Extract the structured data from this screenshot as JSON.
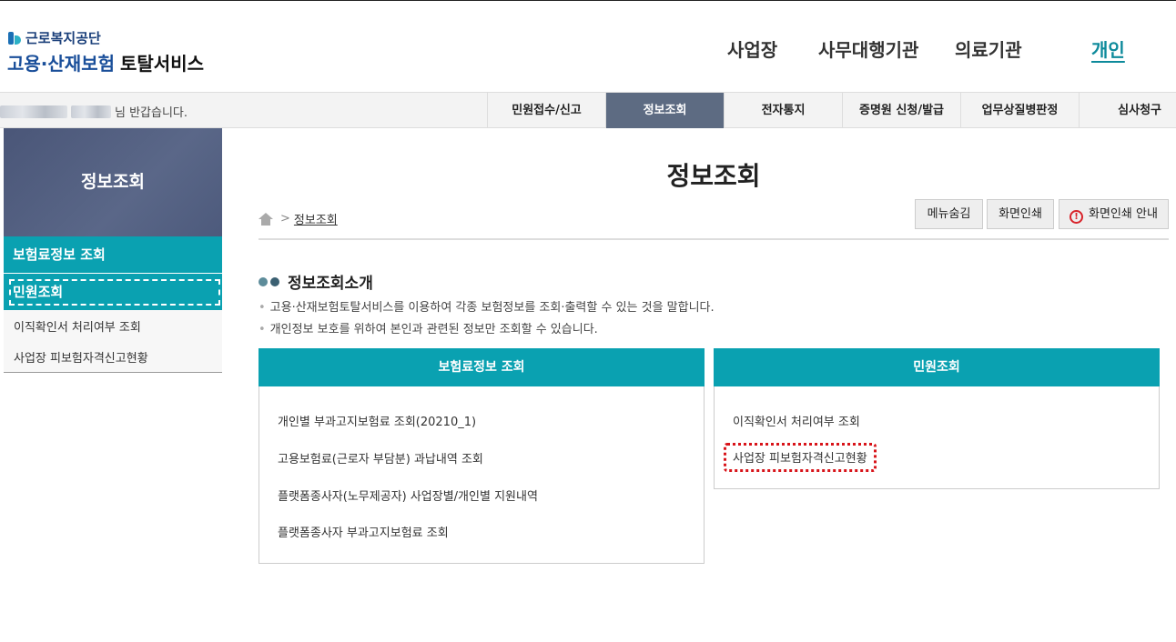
{
  "header": {
    "org_name": "근로복지공단",
    "service_name_a": "고용·산재보험",
    "service_name_b": "토탈서비스",
    "nav": [
      {
        "label": "사업장"
      },
      {
        "label": "사무대행기관"
      },
      {
        "label": "의료기관"
      },
      {
        "label": "개인"
      }
    ]
  },
  "menubar": {
    "greeting": "님 반갑습니다.",
    "tabs": [
      {
        "label": "민원접수/신고"
      },
      {
        "label": "정보조회"
      },
      {
        "label": "전자통지"
      },
      {
        "label": "증명원 신청/발급"
      },
      {
        "label": "업무상질병판정"
      },
      {
        "label": "심사청구"
      }
    ]
  },
  "sidebar": {
    "title": "정보조회",
    "category": "보험료정보 조회",
    "selected": "민원조회",
    "items": [
      {
        "label": "이직확인서 처리여부 조회"
      },
      {
        "label": "사업장 피보험자격신고현황"
      }
    ]
  },
  "main": {
    "title": "정보조회",
    "breadcrumb": "정보조회",
    "buttons": {
      "hide_menu": "메뉴숨김",
      "print": "화면인쇄",
      "print_guide": "화면인쇄 안내"
    },
    "intro_title": "정보조회소개",
    "intro_lines": [
      "고용·산재보험토탈서비스를 이용하여 각종 보험정보를 조회·출력할 수 있는 것을 말합니다.",
      "개인정보 보호를 위하여 본인과 관련된 정보만 조회할 수 있습니다."
    ],
    "panels": [
      {
        "title": "보험료정보 조회",
        "items": [
          {
            "label": "개인별 부과고지보험료 조회(20210_1)"
          },
          {
            "label": "고용보험료(근로자 부담분) 과납내역 조회"
          },
          {
            "label": "플랫폼종사자(노무제공자) 사업장별/개인별 지원내역"
          },
          {
            "label": "플랫폼종사자 부과고지보험료 조회"
          }
        ]
      },
      {
        "title": "민원조회",
        "items": [
          {
            "label": "이직확인서 처리여부 조회"
          },
          {
            "label": "사업장 피보험자격신고현황"
          }
        ]
      }
    ]
  },
  "colors": {
    "accent": "#0aa1b1",
    "active_tab": "#5d6b82",
    "highlight": "#d8141a"
  }
}
